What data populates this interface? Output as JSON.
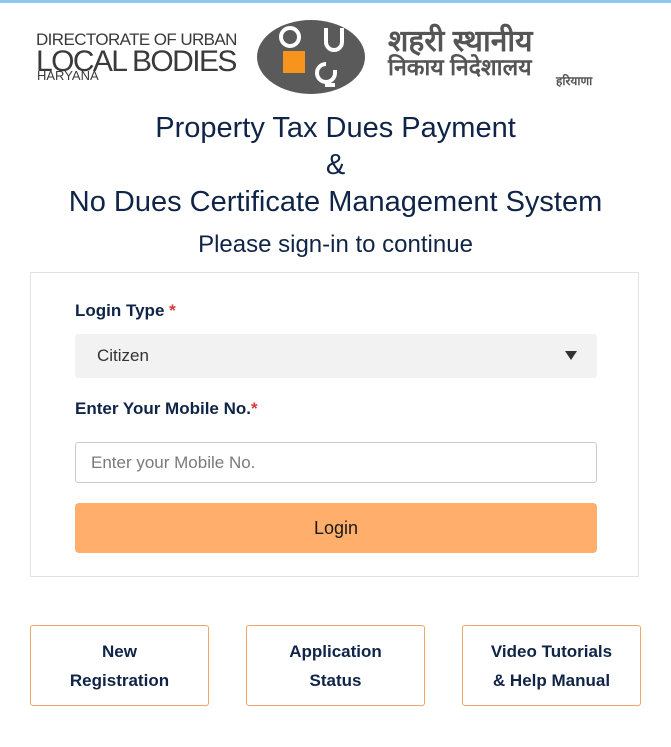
{
  "header": {
    "left_logo": {
      "line1": "DIRECTORATE OF URBAN",
      "line2": "LOCAL BODIES",
      "line3": "HARYANA"
    },
    "right_logo": {
      "line1": "शहरी स्थानीय",
      "line2": "निकाय निदेशालय",
      "line3": "हरियाणा"
    },
    "emblem": {
      "name": "ulb-emblem-icon",
      "accent": "#f7941d",
      "dark": "#5a5a5a"
    }
  },
  "titles": {
    "line1": "Property Tax Dues Payment",
    "line2": "&",
    "line3": "No Dues Certificate Management System",
    "subtitle": "Please sign-in to continue"
  },
  "form": {
    "login_type_label": "Login Type",
    "login_type_required": "*",
    "login_type_value": "Citizen",
    "mobile_label": "Enter Your Mobile No.",
    "mobile_required": "*",
    "mobile_placeholder": "Enter your Mobile No.",
    "mobile_value": "",
    "login_button": "Login"
  },
  "links": {
    "new_registration_1": "New",
    "new_registration_2": "Registration",
    "application_status_1": "Application",
    "application_status_2": "Status",
    "video_tutorials_1": "Video Tutorials",
    "video_tutorials_2": "& Help Manual"
  },
  "colors": {
    "primary_text": "#0f2447",
    "accent_orange": "#ffaf6b",
    "border_orange": "#f0a467",
    "required_red": "#d23b3b",
    "top_bar": "#8cc8f0"
  }
}
